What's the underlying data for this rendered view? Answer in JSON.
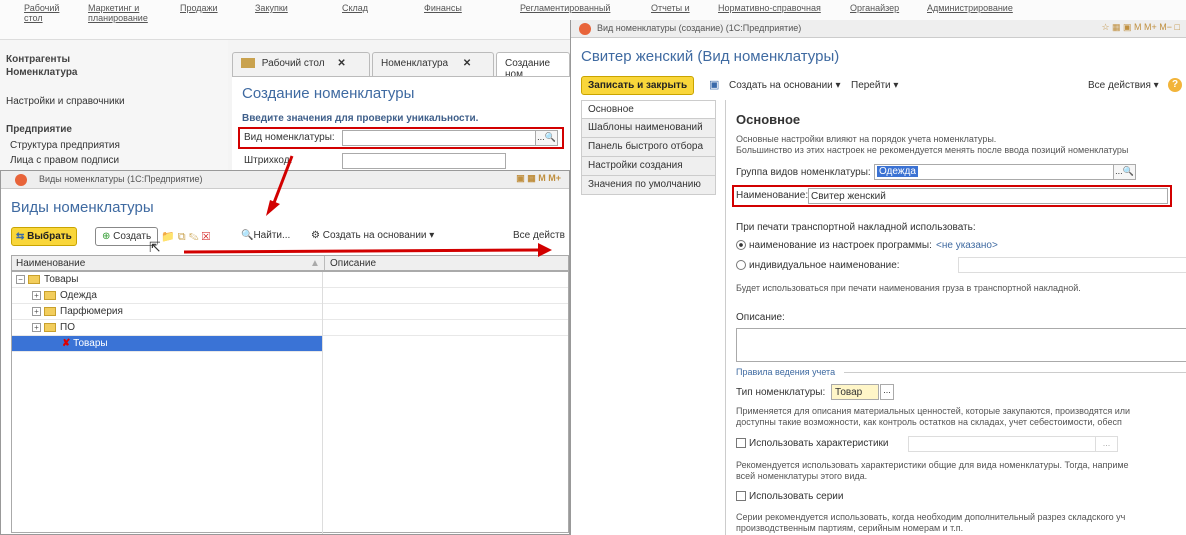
{
  "topbar": {
    "items": [
      {
        "l1": "Рабочий",
        "l2": "стол"
      },
      {
        "l1": "Маркетинг и",
        "l2": "планирование"
      },
      {
        "l1": "Продажи",
        "l2": ""
      },
      {
        "l1": "Закупки",
        "l2": ""
      },
      {
        "l1": "Склад",
        "l2": ""
      },
      {
        "l1": "Финансы",
        "l2": ""
      },
      {
        "l1": "Регламентированный",
        "l2": ""
      },
      {
        "l1": "Отчеты и",
        "l2": ""
      },
      {
        "l1": "Нормативно-справочная",
        "l2": ""
      },
      {
        "l1": "Органайзер",
        "l2": ""
      },
      {
        "l1": "Администрирование",
        "l2": ""
      }
    ]
  },
  "leftpanel": {
    "items": [
      "Контрагенты",
      "Номенклатура",
      "Настройки и справочники",
      "Предприятие",
      "Структура предприятия",
      "Лица с правом подписи"
    ]
  },
  "main": {
    "tabs": [
      "Рабочий стол",
      "Номенклатура",
      "Создание ном"
    ],
    "form_title": "Создание номенклатуры",
    "prompt": "Введите значения для проверки уникальности.",
    "field_kind_label": "Вид номенклатуры:",
    "field_barcode_label": "Штрихкод:"
  },
  "dialog": {
    "window_title": "Виды номенклатуры (1С:Предприятие)",
    "title": "Виды номенклатуры",
    "btn_select": "Выбрать",
    "btn_create": "Создать",
    "btn_find": "Найти...",
    "btn_create_based": "Создать на основании",
    "btn_all_actions": "Все действ",
    "col_name": "Наименование",
    "col_desc": "Описание",
    "rows": [
      "Товары",
      "Одежда",
      "Парфюмерия",
      "ПО",
      "Товары"
    ]
  },
  "form": {
    "window_title": "Вид номенклатуры (создание) (1С:Предприятие)",
    "title": "Свитер женский (Вид номенклатуры)",
    "btn_save_close": "Записать и закрыть",
    "btn_create_based": "Создать на основании",
    "btn_goto": "Перейти",
    "btn_all_actions": "Все действия",
    "side_items": [
      "Основное",
      "Шаблоны наименований",
      "Панель быстрого отбора",
      "Настройки создания",
      "Значения по умолчанию"
    ],
    "section_title": "Основное",
    "section_note1": "Основные настройки влияют на порядок учета номенклатуры.",
    "section_note2": "Большинство из этих настроек не рекомендуется менять после ввода позиций номенклатуры",
    "group_label": "Группа видов номенклатуры:",
    "group_value": "Одежда",
    "name_label": "Наименование:",
    "name_value": "Свитер женский",
    "print_label": "При печати транспортной накладной использовать:",
    "radio1": "наименование из настроек программы:",
    "radio1_value": "<не указано>",
    "radio2": "индивидуальное наименование:",
    "print_note": "Будет использоваться при печати наименования груза в транспортной накладной.",
    "desc_label": "Описание:",
    "rules_label": "Правила ведения учета",
    "type_label": "Тип номенклатуры:",
    "type_value": "Товар",
    "type_note1": "Применяется для описания материальных ценностей, которые закупаются, производятся или",
    "type_note2": "доступны такие возможности, как контроль остатков на складах, учет себестоимости, обесп",
    "chk_characteristics": "Использовать характеристики",
    "char_note1": "Рекомендуется использовать характеристики общие для вида номенклатуры. Тогда, наприме",
    "char_note2": "всей номенклатуры этого вида.",
    "chk_series": "Использовать серии",
    "series_note1": "Серии рекомендуется использовать, когда необходим дополнительный разрез складского уч",
    "series_note2": "производственным партиям, серийным номерам и т.п."
  },
  "colors": {
    "accent": "#3f6aa1",
    "highlight": "#d20000",
    "yellow": "#f9d63a"
  }
}
